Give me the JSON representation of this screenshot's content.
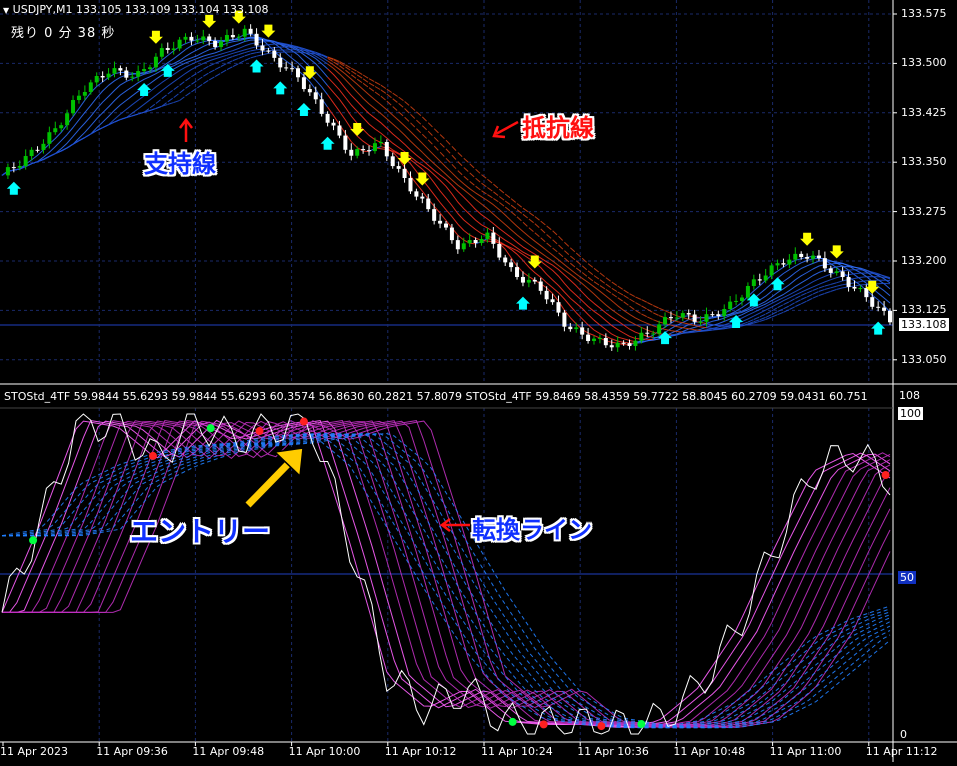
{
  "header": {
    "symbol_line": "USDJPY,M1  133.105 133.109 133.104 133.108",
    "countdown": "残り 0 分 38 秒"
  },
  "price_axis": {
    "ticks": [
      "133.575",
      "133.500",
      "133.425",
      "133.350",
      "133.275",
      "133.200",
      "133.125",
      "133.050"
    ],
    "current_price": "133.108"
  },
  "indicator": {
    "title": "STOStd_4TF 59.9844 55.6293 59.9844 55.6293 60.3574 56.8630 60.2821 57.8079  STOStd_4TF 59.8469 58.4359 59.7722 58.8045 60.2709 59.0431 60.751",
    "scale_top": "108",
    "scale_100": "100",
    "scale_50": "50",
    "scale_0": "0"
  },
  "time_axis": {
    "labels": [
      "11 Apr 2023",
      "11 Apr 09:36",
      "11 Apr 09:48",
      "11 Apr 10:00",
      "11 Apr 10:12",
      "11 Apr 10:24",
      "11 Apr 10:36",
      "11 Apr 10:48",
      "11 Apr 11:00",
      "11 Apr 11:12"
    ]
  },
  "annotations": {
    "support": "支持線",
    "resistance": "抵抗線",
    "entry": "エントリー",
    "turning": "転換ライン"
  },
  "colors": {
    "background": "#000000",
    "grid": "#1a2a6a",
    "bull_candle": "#00c000",
    "bear_candle": "#ffffff",
    "support_band": "#2060ff",
    "resistance_band": "#ff3020",
    "stoch_fast": "#ff40ff",
    "stoch_slow": "#2080ff",
    "up_arrow": "#00ffff",
    "down_arrow": "#ffff00",
    "callout_blue": "#1030ff",
    "callout_red": "#ff1010",
    "entry_arrow": "#ffcc00"
  },
  "chart_data": {
    "type": "candlestick",
    "symbol": "USDJPY",
    "timeframe": "M1",
    "ylim": [
      133.03,
      133.59
    ],
    "close_trend": [
      133.33,
      133.36,
      133.4,
      133.46,
      133.49,
      133.48,
      133.52,
      133.54,
      133.53,
      133.55,
      133.51,
      133.48,
      133.42,
      133.36,
      133.38,
      133.32,
      133.27,
      133.22,
      133.24,
      133.18,
      133.16,
      133.1,
      133.08,
      133.07,
      133.09,
      133.12,
      133.11,
      133.13,
      133.17,
      133.2,
      133.21,
      133.18,
      133.15,
      133.11
    ],
    "oscillator": {
      "ylim": [
        0,
        108
      ],
      "fast": [
        38,
        66,
        98,
        96,
        86,
        98,
        92,
        96,
        98,
        60,
        18,
        8,
        14,
        4,
        3,
        3,
        2,
        4,
        14,
        32,
        58,
        82,
        88,
        80
      ],
      "slow": [
        62,
        64,
        78,
        84,
        88,
        90,
        91,
        93,
        94,
        84,
        64,
        44,
        26,
        12,
        5,
        3,
        2,
        2,
        4,
        10,
        20,
        30,
        36,
        40
      ]
    }
  }
}
